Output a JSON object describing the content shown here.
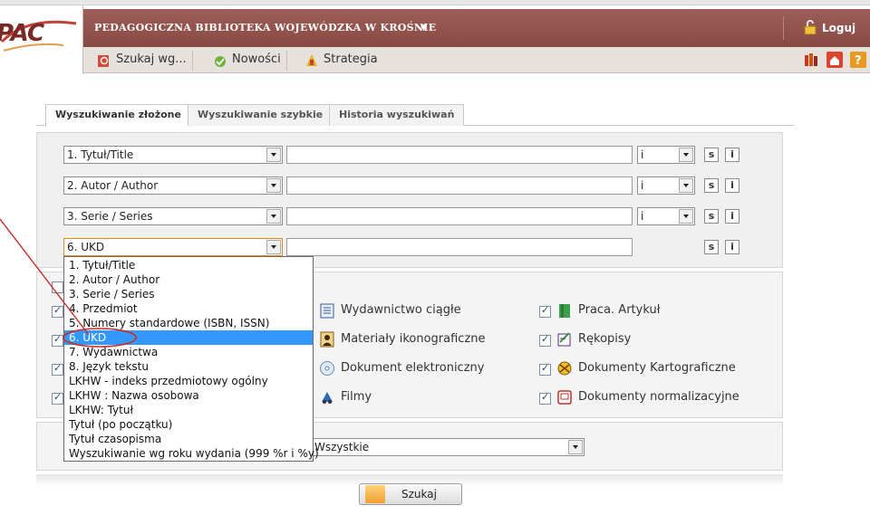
{
  "header": {
    "logo_text": "PAC",
    "library_title": "PEDAGOGICZNA BIBLIOTEKA WOJEWÓDZKA W KROŚNIE",
    "library_caret": "▼",
    "login_label": "Loguj"
  },
  "toolbar": {
    "search_by": "Szukaj wg...",
    "news": "Nowości",
    "strategy": "Strategia"
  },
  "tabs": [
    {
      "label": "Wyszukiwanie złożone",
      "active": true
    },
    {
      "label": "Wyszukiwanie szybkie",
      "active": false
    },
    {
      "label": "Historia wyszukiwań",
      "active": false
    }
  ],
  "search_rows": [
    {
      "field": "1. Tytuł/Title",
      "operator": "i",
      "s": "s",
      "i": "i"
    },
    {
      "field": "2. Autor / Author",
      "operator": "i",
      "s": "s",
      "i": "i"
    },
    {
      "field": "3. Serie / Series",
      "operator": "i",
      "s": "s",
      "i": "i"
    },
    {
      "field": "6. UKD",
      "s": "s",
      "i": "i"
    }
  ],
  "dropdown_options": [
    "1. Tytuł/Title",
    "2. Autor / Author",
    "3. Serie / Series",
    "4. Przedmiot",
    "5. Numery standardowe (ISBN, ISSN)",
    "6. UKD",
    "7. Wydawnictwa",
    "8. Język tekstu",
    "LKHW - indeks przedmiotowy ogólny",
    "LKHW : Nazwa osobowa",
    "LKHW: Tytuł",
    "Tytuł (po początku)",
    "Tytuł czasopisma",
    "Wyszukiwanie wg roku wydania (999 %r i %y)"
  ],
  "dropdown_selected": "6. UKD",
  "doc_types": [
    {
      "label": "Wydawnictwo ciągłe",
      "checked": true
    },
    {
      "label": "Materiały ikonograficzne",
      "checked": true
    },
    {
      "label": "Dokument elektroniczny",
      "checked": true
    },
    {
      "label": "Filmy",
      "checked": true
    },
    {
      "label": "Praca. Artykuł",
      "checked": true
    },
    {
      "label": "Rękopisy",
      "checked": true
    },
    {
      "label": "Dokumenty Kartograficzne",
      "checked": true
    },
    {
      "label": "Dokumenty normalizacyjne",
      "checked": true
    }
  ],
  "year_select": "Wszystkie",
  "search_button": "Szukaj",
  "colors": {
    "topbar": "#8a4a44",
    "toolbar": "#e7e1dd",
    "selection": "#3399ff",
    "annotation": "#cc2a2a"
  }
}
